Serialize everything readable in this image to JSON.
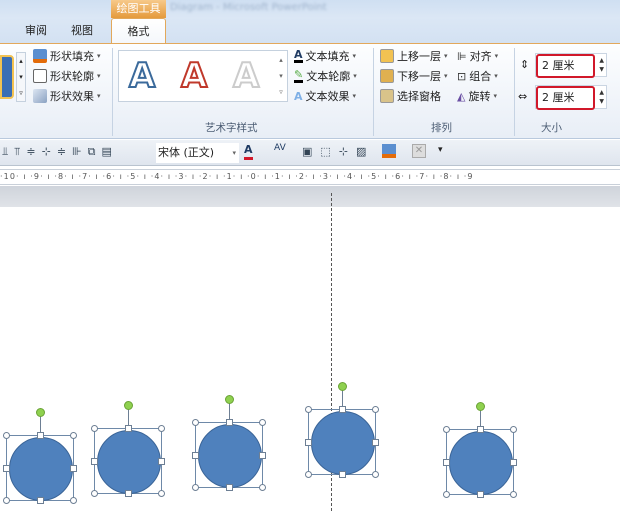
{
  "title_bar": {
    "title": "Diagram - Microsoft PowerPoint",
    "context_tab": "绘图工具"
  },
  "tabs": [
    {
      "label": "审阅"
    },
    {
      "label": "视图"
    },
    {
      "label": "格式",
      "active": true
    }
  ],
  "ribbon": {
    "shape_styles": {
      "fill": "形状填充",
      "outline": "形状轮廓",
      "effects": "形状效果"
    },
    "wordart": {
      "gallery": [
        "A",
        "A",
        "A"
      ],
      "text_fill": "文本填充",
      "text_outline": "文本轮廓",
      "text_effects": "文本效果",
      "label": "艺术字样式"
    },
    "arrange": {
      "bring_forward": "上移一层",
      "send_backward": "下移一层",
      "selection_pane": "选择窗格",
      "align": "对齐",
      "group": "组合",
      "rotate": "旋转",
      "label": "排列"
    },
    "size": {
      "height": "2 厘米",
      "width": "2 厘米",
      "label": "大小"
    }
  },
  "toolbar": {
    "font": "宋体 (正文)"
  },
  "ruler": {
    "text": "·10· ı ·9· ı ·8· ı ·7· ı ·6· ı ·5· ı ·4· ı ·3· ı ·2· ı ·1· ı ·0· ı ·1· ı ·2· ı ·3· ı ·4· ı ·5· ı ·6· ı ·7· ı ·8· ı ·9"
  },
  "colors": {
    "shape_fill": "#4f81bd",
    "accent": "#e2a85b",
    "highlight": "#d1182a"
  }
}
